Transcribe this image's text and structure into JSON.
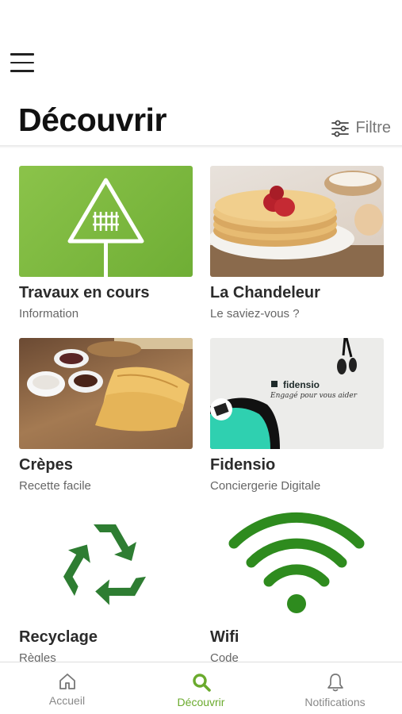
{
  "header": {
    "title": "Découvrir",
    "filter_label": "Filtre"
  },
  "cards": [
    {
      "title": "Travaux en cours",
      "subtitle": "Information",
      "image": "railway-crossing-sign"
    },
    {
      "title": "La Chandeleur",
      "subtitle": "Le saviez-vous ?",
      "image": "pancake-stack-photo"
    },
    {
      "title": "Crèpes",
      "subtitle": "Recette facile",
      "image": "crepes-photo"
    },
    {
      "title": "Fidensio",
      "subtitle": "Conciergerie Digitale",
      "image": "fidensio-banner",
      "brand": "fidensio",
      "tagline": "Engagé pour vous aider"
    },
    {
      "title": "Recyclage",
      "subtitle": "Règles",
      "image": "recycle-icon"
    },
    {
      "title": "Wifi",
      "subtitle": "Code",
      "image": "wifi-icon"
    }
  ],
  "tabbar": {
    "items": [
      {
        "label": "Accueil",
        "icon": "home-icon",
        "active": false
      },
      {
        "label": "Découvrir",
        "icon": "search-icon",
        "active": true
      },
      {
        "label": "Notifications",
        "icon": "bell-icon",
        "active": false
      }
    ]
  },
  "colors": {
    "accent": "#6aaa2d",
    "icon_green": "#2e7d32",
    "card_green": "#7cb83f"
  }
}
